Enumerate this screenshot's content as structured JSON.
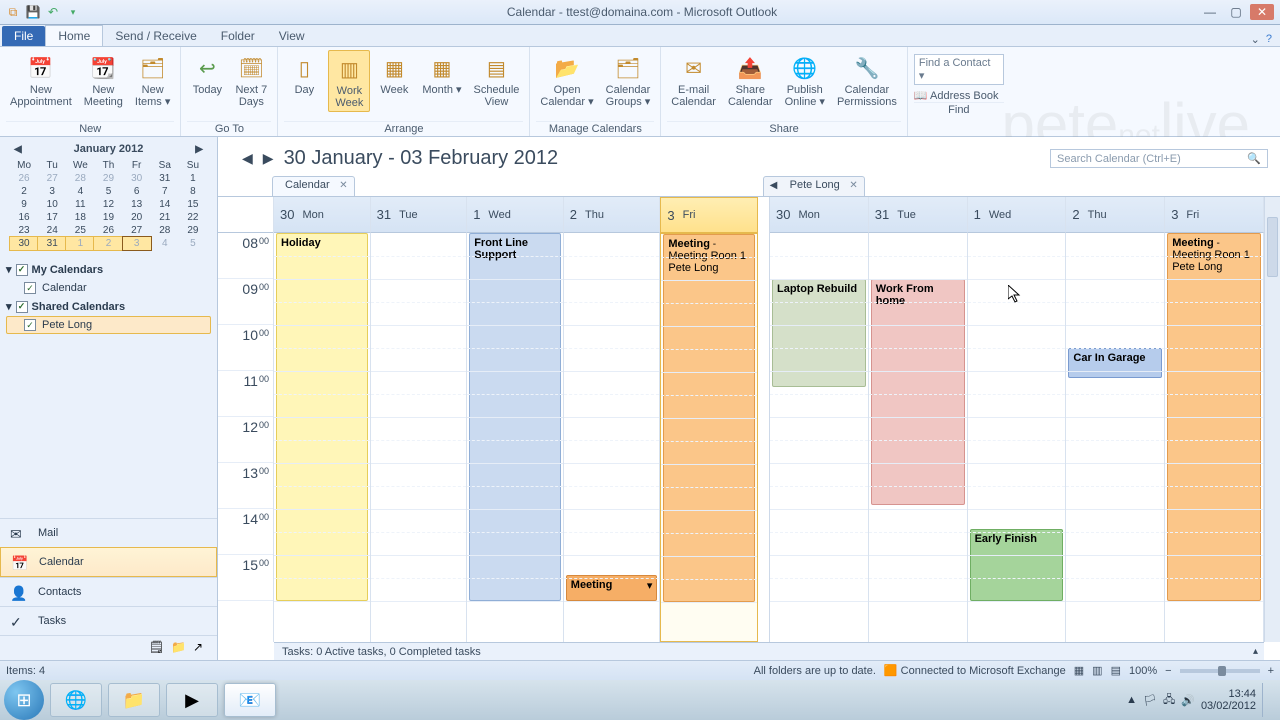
{
  "window": {
    "title": "Calendar - ttest@domaina.com - Microsoft Outlook"
  },
  "tabs": {
    "file": "File",
    "home": "Home",
    "sendrecv": "Send / Receive",
    "folder": "Folder",
    "view": "View"
  },
  "ribbon": {
    "new": {
      "appt": "New\nAppointment",
      "meet": "New\nMeeting",
      "items": "New\nItems ▾",
      "label": "New"
    },
    "goto": {
      "today": "Today",
      "next7": "Next 7\nDays",
      "label": "Go To"
    },
    "arrange": {
      "day": "Day",
      "work": "Work\nWeek",
      "week": "Week",
      "month": "Month ▾",
      "sched": "Schedule\nView",
      "label": "Arrange"
    },
    "manage": {
      "open": "Open\nCalendar ▾",
      "groups": "Calendar\nGroups ▾",
      "label": "Manage Calendars"
    },
    "share": {
      "email": "E-mail\nCalendar",
      "share": "Share\nCalendar",
      "publish": "Publish\nOnline ▾",
      "perm": "Calendar\nPermissions",
      "label": "Share"
    },
    "find": {
      "contact": "Find a Contact",
      "address": "Address Book",
      "label": "Find"
    }
  },
  "miniCal": {
    "title": "January 2012",
    "dow": [
      "Mo",
      "Tu",
      "We",
      "Th",
      "Fr",
      "Sa",
      "Su"
    ],
    "rows": [
      [
        "26",
        "27",
        "28",
        "29",
        "30",
        "31",
        "1"
      ],
      [
        "2",
        "3",
        "4",
        "5",
        "6",
        "7",
        "8"
      ],
      [
        "9",
        "10",
        "11",
        "12",
        "13",
        "14",
        "15"
      ],
      [
        "16",
        "17",
        "18",
        "19",
        "20",
        "21",
        "22"
      ],
      [
        "23",
        "24",
        "25",
        "26",
        "27",
        "28",
        "29"
      ],
      [
        "30",
        "31",
        "1",
        "2",
        "3",
        "4",
        "5"
      ]
    ]
  },
  "calGroups": {
    "my": "My Calendars",
    "cal": "Calendar",
    "shared": "Shared Calendars",
    "pete": "Pete Long"
  },
  "nav": {
    "mail": "Mail",
    "calendar": "Calendar",
    "contacts": "Contacts",
    "tasks": "Tasks"
  },
  "header": {
    "range": "30 January - 03 February 2012",
    "search": "Search Calendar (Ctrl+E)"
  },
  "calTabs": {
    "cal": "Calendar",
    "pete": "Pete Long"
  },
  "days": [
    {
      "n": "30",
      "d": "Mon"
    },
    {
      "n": "31",
      "d": "Tue"
    },
    {
      "n": "1",
      "d": "Wed"
    },
    {
      "n": "2",
      "d": "Thu"
    },
    {
      "n": "3",
      "d": "Fri"
    }
  ],
  "hours": [
    "08",
    "09",
    "10",
    "11",
    "12",
    "13",
    "14",
    "15"
  ],
  "events1": {
    "holiday": "Holiday",
    "front": "Front Line Support",
    "meeting": "Meeting",
    "meetingSub": "Meeting Roon 1",
    "meetingWho": "Pete Long",
    "meetingLate": "Meeting"
  },
  "events2": {
    "laptop": "Laptop Rebuild",
    "wfh": "Work From home",
    "car": "Car In Garage",
    "early": "Early Finish",
    "meeting": "Meeting",
    "meetingSub": "Meeting Roon 1",
    "meetingWho": "Pete Long"
  },
  "tasksBar": "Tasks: 0 Active tasks, 0 Completed tasks",
  "status": {
    "items": "Items: 4",
    "folders": "All folders are up to date.",
    "conn": "Connected to Microsoft Exchange",
    "zoom": "100%"
  },
  "tray": {
    "time": "13:44",
    "date": "03/02/2012"
  }
}
